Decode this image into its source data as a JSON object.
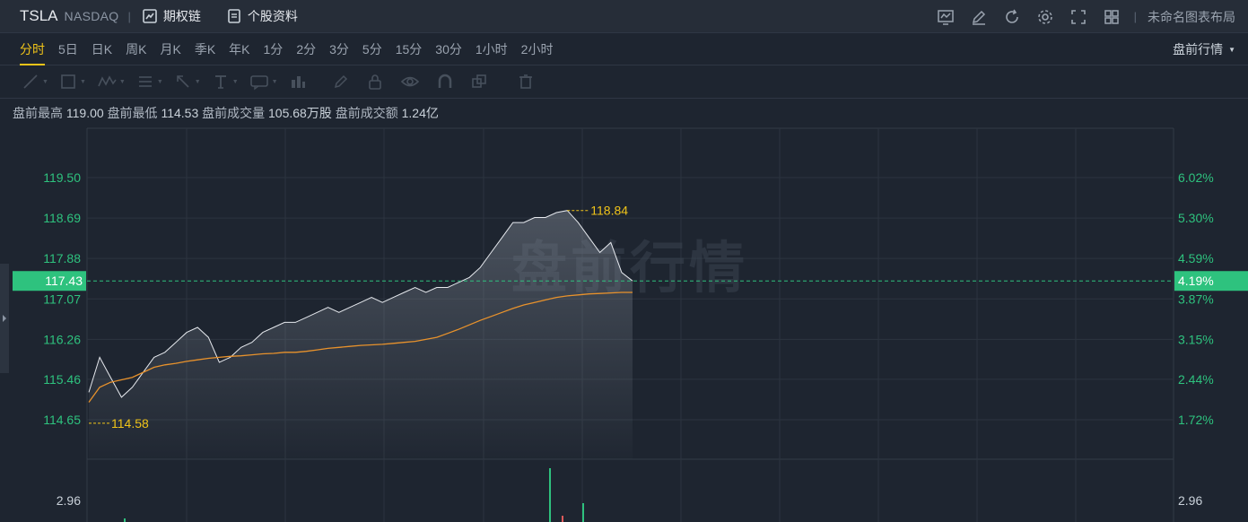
{
  "header": {
    "ticker": "TSLA",
    "exchange": "NASDAQ",
    "options_chain": "期权链",
    "stock_profile": "个股资料",
    "layout_name": "未命名图表布局"
  },
  "periods": [
    "分时",
    "5日",
    "日K",
    "周K",
    "月K",
    "季K",
    "年K",
    "1分",
    "2分",
    "3分",
    "5分",
    "15分",
    "30分",
    "1小时",
    "2小时"
  ],
  "active_period": "分时",
  "session_label": "盘前行情",
  "stats": {
    "high_label": "盘前最高",
    "high": "119.00",
    "low_label": "盘前最低",
    "low": "114.53",
    "volume_label": "盘前成交量",
    "volume": "105.68万股",
    "amount_label": "盘前成交额",
    "amount": "1.24亿"
  },
  "watermark": "盘前行情",
  "colors": {
    "accent": "#f0c419",
    "up": "#2ec27e",
    "down": "#e05a5a",
    "price_line": "#e6e9ee",
    "avg_line": "#e8922c"
  },
  "chart_data": {
    "type": "line",
    "y_left_ticks": [
      "119.50",
      "118.69",
      "117.88",
      "117.07",
      "116.26",
      "115.46",
      "114.65"
    ],
    "y_right_ticks": [
      "6.02%",
      "5.30%",
      "4.59%",
      "3.87%",
      "3.15%",
      "2.44%",
      "1.72%"
    ],
    "ylim": [
      114.65,
      119.5
    ],
    "current_price": "117.43",
    "current_change": "4.19%",
    "max_marker": "118.84",
    "min_marker": "114.58",
    "volume_tick_left": "2.96",
    "volume_tick_right": "2.96",
    "price_series": [
      115.2,
      115.9,
      115.5,
      115.1,
      115.3,
      115.6,
      115.9,
      116.0,
      116.2,
      116.4,
      116.5,
      116.3,
      115.8,
      115.9,
      116.1,
      116.2,
      116.4,
      116.5,
      116.6,
      116.6,
      116.7,
      116.8,
      116.9,
      116.8,
      116.9,
      117.0,
      117.1,
      117.0,
      117.1,
      117.2,
      117.3,
      117.2,
      117.3,
      117.3,
      117.4,
      117.5,
      117.7,
      118.0,
      118.3,
      118.6,
      118.6,
      118.7,
      118.7,
      118.8,
      118.84,
      118.6,
      118.3,
      118.0,
      118.2,
      117.6,
      117.43
    ],
    "avg_series": [
      115.0,
      115.3,
      115.4,
      115.45,
      115.5,
      115.6,
      115.7,
      115.75,
      115.78,
      115.82,
      115.85,
      115.88,
      115.9,
      115.92,
      115.93,
      115.95,
      115.97,
      115.98,
      116.0,
      116.0,
      116.02,
      116.05,
      116.08,
      116.1,
      116.12,
      116.14,
      116.15,
      116.16,
      116.18,
      116.2,
      116.22,
      116.26,
      116.3,
      116.38,
      116.46,
      116.55,
      116.64,
      116.72,
      116.8,
      116.88,
      116.95,
      117.0,
      117.05,
      117.1,
      117.13,
      117.15,
      117.17,
      117.18,
      117.19,
      117.2,
      117.2
    ]
  }
}
